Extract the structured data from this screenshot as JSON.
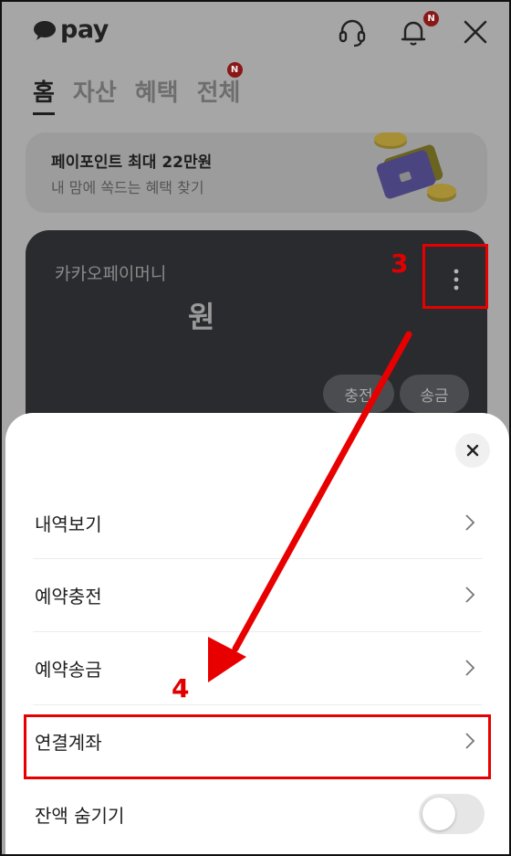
{
  "header": {
    "logo_text": "pay",
    "notification_badge": "N",
    "icons": [
      "headset-icon",
      "bell-icon",
      "close-icon"
    ]
  },
  "tabs": [
    {
      "label": "홈",
      "active": true
    },
    {
      "label": "자산",
      "active": false
    },
    {
      "label": "혜택",
      "active": false
    },
    {
      "label": "전체",
      "active": false,
      "badge": "N"
    }
  ],
  "promo": {
    "title": "페이포인트 최대 22만원",
    "subtitle": "내 맘에 쏙드는 혜택 찾기"
  },
  "money_card": {
    "label": "카카오페이머니",
    "amount": "원",
    "buttons": [
      "충전",
      "송금"
    ]
  },
  "sheet": {
    "items": [
      {
        "label": "내역보기"
      },
      {
        "label": "예약충전"
      },
      {
        "label": "예약송금"
      },
      {
        "label": "연결계좌"
      },
      {
        "label": "잔액 숨기기",
        "toggle": false
      }
    ]
  },
  "annotations": {
    "step3": "3",
    "step4": "4",
    "color": "#e80000"
  },
  "colors": {
    "card_bg": "#2a2b2f",
    "overlay_bg": "#a6a6a6",
    "badge": "#8b1818"
  }
}
